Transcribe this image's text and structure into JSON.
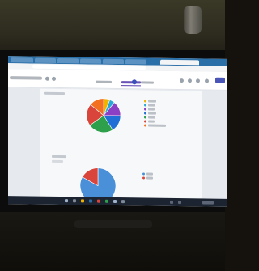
{
  "scene": {
    "description": "",
    "colors": {
      "screen_bg": "#e6e9ee",
      "browser_tabbar": "#2a6fa8",
      "accent": "#5b3fb0",
      "send_button": "#4a55b8",
      "taskbar": "#1c2431"
    }
  },
  "chart_data": [
    {
      "type": "pie",
      "title": "",
      "values": [
        6,
        5,
        14,
        16,
        24,
        21,
        14
      ],
      "colors": [
        "#f0b400",
        "#29a8d8",
        "#8b3fc4",
        "#1f6fd6",
        "#2e9f4a",
        "#d9453b",
        "#f37021"
      ],
      "legend_placement": "right",
      "legend_entries": 7
    },
    {
      "type": "pie",
      "title": "",
      "values": [
        83,
        17
      ],
      "colors": [
        "#4a90d9",
        "#d9453b"
      ],
      "legend_placement": "right",
      "legend_entries": 2
    }
  ],
  "icons": {
    "settings": "gear-icon",
    "preview": "eye-icon",
    "undo": "undo-icon",
    "redo": "redo-icon",
    "more": "more-icon"
  }
}
